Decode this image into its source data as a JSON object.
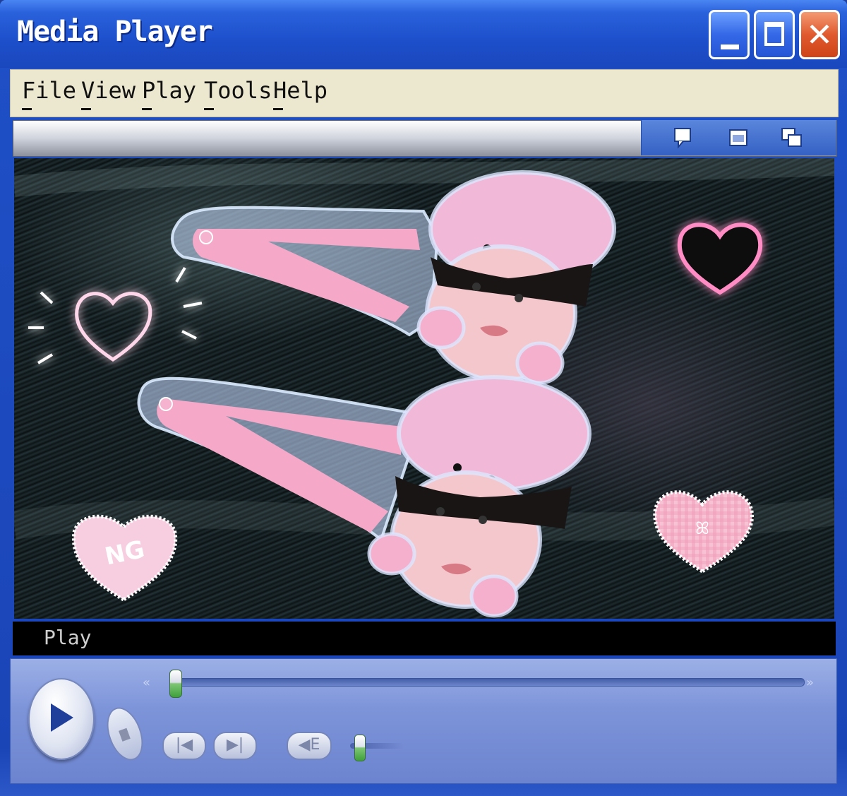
{
  "window": {
    "title": "Media Player",
    "controls": {
      "minimize_icon": "minimize-icon",
      "maximize_icon": "maximize-icon",
      "close_label": "✕"
    }
  },
  "menu": [
    {
      "label": "File",
      "underline": "F"
    },
    {
      "label": "View",
      "underline": "V"
    },
    {
      "label": "Play",
      "underline": "P"
    },
    {
      "label": "Tools",
      "underline": "T"
    },
    {
      "label": "Help",
      "underline": "H"
    }
  ],
  "infobar": {
    "icons": [
      "speech-bubble-icon",
      "compact-mode-icon",
      "switch-skin-icon"
    ]
  },
  "video": {
    "sticker_text": "NG",
    "colors": {
      "pink": "#f6b6d2",
      "glow": "#ff7eb9",
      "hair": "#14201f"
    }
  },
  "status": {
    "text": "Play"
  },
  "transport": {
    "play_icon": "play-icon",
    "stop_icon": "stop-icon",
    "prev_label": "|◀",
    "next_label": "▶|",
    "mute_label": "◀E",
    "rewind_label": "«",
    "forward_label": "»",
    "seek_position": 0.0,
    "volume_level": 0.15
  }
}
